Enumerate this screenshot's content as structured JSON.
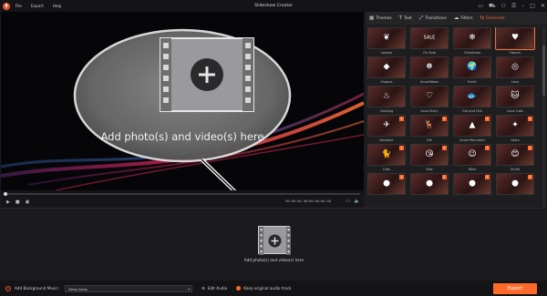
{
  "app": {
    "title": "Slideshow Creator"
  },
  "menu": {
    "items": [
      "File",
      "Export",
      "Help"
    ]
  },
  "window_controls": [
    "chat-icon",
    "cart-icon",
    "user-icon",
    "settings-icon",
    "minimize-icon",
    "maximize-icon",
    "close-icon"
  ],
  "preview": {
    "callout_text": "Add photo(s) and video(s) here",
    "timecode": "00:00:00.00/00:00:00.00",
    "progress": 0
  },
  "tabs": [
    {
      "label": "Themes",
      "icon": "themes-icon",
      "active": false
    },
    {
      "label": "Text",
      "icon": "text-icon",
      "active": false
    },
    {
      "label": "Transitions",
      "icon": "transitions-icon",
      "active": false
    },
    {
      "label": "Filters",
      "icon": "filters-icon",
      "active": false
    },
    {
      "label": "Elements",
      "icon": "elements-icon",
      "active": true
    }
  ],
  "elements": [
    {
      "label": "Leaves",
      "glyph": "❦"
    },
    {
      "label": "On Sale",
      "glyph": "SALE"
    },
    {
      "label": "Christmas",
      "glyph": "❄"
    },
    {
      "label": "Hearts",
      "glyph": "♥",
      "selected": true
    },
    {
      "label": "Shapes",
      "glyph": "◆"
    },
    {
      "label": "Snowflakes",
      "glyph": "❅"
    },
    {
      "label": "Earth",
      "glyph": "🌍"
    },
    {
      "label": "Lens",
      "glyph": "◎"
    },
    {
      "label": "Cooking",
      "glyph": "♨"
    },
    {
      "label": "Love Story",
      "glyph": "♡"
    },
    {
      "label": "Cat and Fish",
      "glyph": "🐟"
    },
    {
      "label": "Love Cats",
      "glyph": "🐱"
    },
    {
      "label": "Airplane",
      "glyph": "✈",
      "download": true
    },
    {
      "label": "Elk",
      "glyph": "🦌",
      "download": true
    },
    {
      "label": "Snow Mountain",
      "glyph": "▲",
      "download": true
    },
    {
      "label": "Stars",
      "glyph": "✦",
      "download": true
    },
    {
      "label": "Cats",
      "glyph": "🐈",
      "download": true
    },
    {
      "label": "Kiss",
      "glyph": "😘",
      "download": true
    },
    {
      "label": "Wink",
      "glyph": "😉",
      "download": true
    },
    {
      "label": "Smile",
      "glyph": "😊",
      "download": true
    },
    {
      "label": "",
      "glyph": "●",
      "download": true
    },
    {
      "label": "",
      "glyph": "●",
      "download": true
    },
    {
      "label": "",
      "glyph": "●",
      "download": true
    },
    {
      "label": "",
      "glyph": "●",
      "download": true
    }
  ],
  "timeline": {
    "drop_text": "Add photo(s) and video(s) here"
  },
  "bottom": {
    "add_music_label": "Add Background Music:",
    "music_value": "Deep Away",
    "edit_audio_label": "Edit Audio",
    "keep_audio_label": "Keep original audio track",
    "export_label": "Export"
  },
  "colors": {
    "accent": "#ff6a2b",
    "brand": "#e8542a"
  }
}
